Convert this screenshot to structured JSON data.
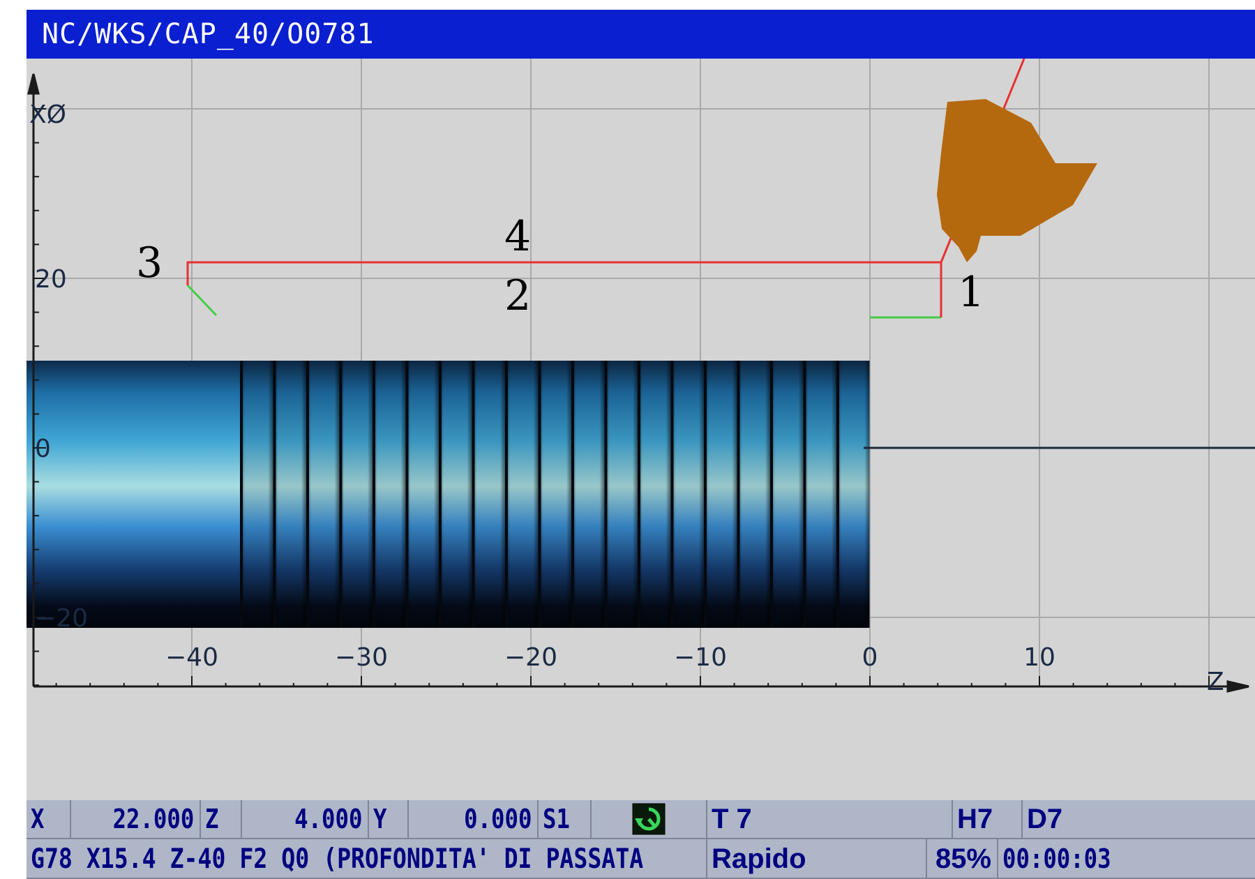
{
  "window": {
    "title": "NC/WKS/CAP_40/O0781"
  },
  "viewport": {
    "axis_x_label": "XØ",
    "axis_z_label": "Z",
    "x_ticks": [
      "20",
      "0",
      "−20"
    ],
    "z_ticks": [
      "−40",
      "−30",
      "−20",
      "−10",
      "0",
      "10"
    ],
    "path_markers": [
      "1",
      "2",
      "3",
      "4"
    ],
    "colors": {
      "background": "#d4d4d4",
      "grid": "#a9a9a9",
      "feed_path": "#e83030",
      "rapid_path": "#44cc44",
      "tool": "#b5690e",
      "workpiece_light": "#a9dde0",
      "workpiece_dark": "#02060c"
    }
  },
  "status": {
    "x_label": "X",
    "x_value": "22.000",
    "z_label": "Z",
    "z_value": "4.000",
    "y_label": "Y",
    "y_value": "0.000",
    "spindle_label": "S1",
    "spindle_icon": "spindle-rotation-icon",
    "tool": "T 7",
    "h_offset": "H7",
    "d_offset": "D7",
    "program_line": "G78 X15.4 Z-40 F2 Q0 (PROFONDITA' DI PASSATA",
    "feed_mode": "Rapido",
    "override": "85%",
    "time": "00:00:03"
  }
}
